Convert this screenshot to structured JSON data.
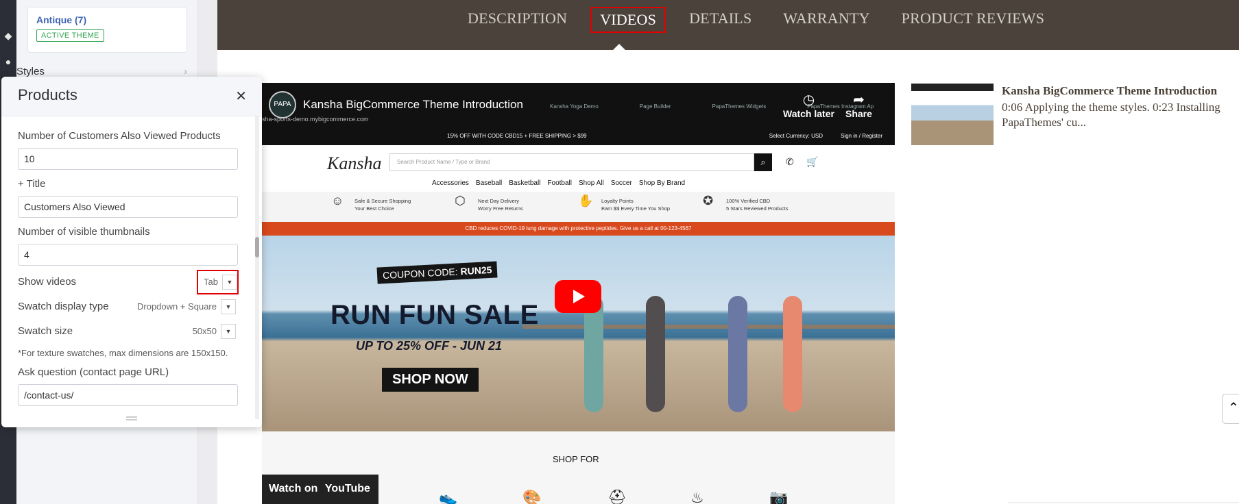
{
  "editor": {
    "theme_card": {
      "name": "Antique (7)",
      "badge": "ACTIVE THEME"
    },
    "styles_label": "Styles",
    "products_panel": {
      "title": "Products",
      "close_icon": "close-icon",
      "fields": {
        "also_viewed_label": "Number of Customers Also Viewed Products",
        "also_viewed_value": "10",
        "title_label": "+ Title",
        "title_value": "Customers Also Viewed",
        "thumbnails_label": "Number of visible thumbnails",
        "thumbnails_value": "4",
        "show_videos_label": "Show videos",
        "show_videos_value": "Tab",
        "swatch_type_label": "Swatch display type",
        "swatch_type_value": "Dropdown + Square",
        "swatch_size_label": "Swatch size",
        "swatch_size_value": "50x50",
        "swatch_note": "*For texture swatches, max dimensions are 150x150.",
        "ask_question_label": "Ask question (contact page URL)",
        "ask_question_value": "/contact-us/"
      }
    }
  },
  "product_tabs": {
    "items": [
      "DESCRIPTION",
      "VIDEOS",
      "DETAILS",
      "WARRANTY",
      "PRODUCT REVIEWS"
    ],
    "active": "VIDEOS"
  },
  "video": {
    "channel_logo": "PAPA",
    "title": "Kansha BigCommerce Theme Introduction",
    "url_text": "sha-sports-demo.mybigcommerce.com",
    "browser_tabs": [
      "Kansha Yoga Demo",
      "Page Builder",
      "PapaThemes Widgets",
      "PapaThemes Instagram Ap"
    ],
    "watch_later": "Watch later",
    "share": "Share",
    "promo": "15% OFF WITH CODE CBD15 + FREE SHIPPING > $99",
    "currency": "Select Currency:  USD",
    "signin": "Sign in / Register",
    "brand": "Kansha",
    "search_placeholder": "Search Product Name / Type or Brand",
    "nav": [
      "Accessories",
      "Baseball",
      "Basketball",
      "Football",
      "Shop All",
      "Soccer",
      "Shop By Brand"
    ],
    "trust": [
      {
        "title": "Safe & Secure Shopping",
        "sub": "Your Best Choice"
      },
      {
        "title": "Next Day Delivery",
        "sub": "Worry Free Returns"
      },
      {
        "title": "Loyalty Points",
        "sub": "Earn $$ Every Time You Shop"
      },
      {
        "title": "100% Verified CBD",
        "sub": "5 Stars Reviewed Products"
      }
    ],
    "red_bar": "CBD reduces COVID-19 lung damage with protective peptides. Give us a call at 00-123-4567",
    "coupon_prefix": "COUPON CODE:",
    "coupon_code": "RUN25",
    "headline": "RUN FUN SALE",
    "subheadline": "UP TO 25% OFF - JUN 21",
    "cta": "SHOP NOW",
    "shop_for": "SHOP FOR",
    "watch_on": "Watch on",
    "youtube": "YouTube"
  },
  "side_video": {
    "title": "Kansha BigCommerce Theme Introduction",
    "description": "0:06 Applying the theme styles. 0:23 Installing PapaThemes' cu..."
  },
  "colors": {
    "tab_bar": "#4b433b",
    "highlight": "#e00000",
    "active_badge": "#2ea44f"
  }
}
